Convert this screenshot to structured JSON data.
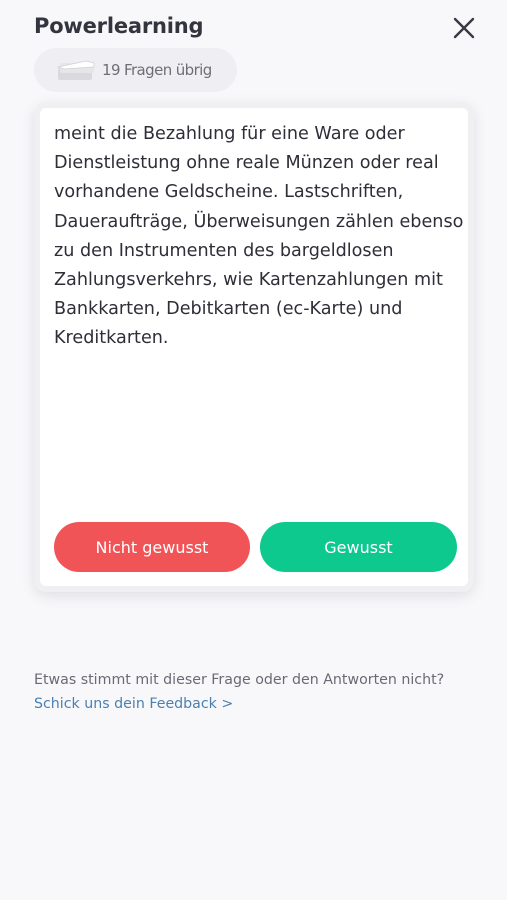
{
  "header": {
    "title": "Powerlearning",
    "close_icon": "close-icon"
  },
  "progress": {
    "label": "19 Fragen übrig",
    "icon": "progress-stack-icon"
  },
  "card": {
    "text": "meint die Bezahlung für eine Ware oder Dienstleistung ohne reale Münzen oder real vorhandene Geldscheine. Lastschriften, Daueraufträge, Überweisungen zählen ebenso zu den Instrumenten des bargeldlosen Zahlungsverkehrs, wie Kartenzahlungen mit Bankkarten, Debitkarten (ec-Karte) und Kreditkarten.",
    "buttons": {
      "not_known": "Nicht gewusst",
      "known": "Gewusst"
    }
  },
  "feedback": {
    "question": "Etwas stimmt mit dieser Frage oder den Antworten nicht?",
    "link": "Schick uns dein Feedback >"
  },
  "colors": {
    "not_known_button": "#f05457",
    "known_button": "#0ec98e",
    "link": "#4a7fb0",
    "background": "#f8f8fb"
  }
}
